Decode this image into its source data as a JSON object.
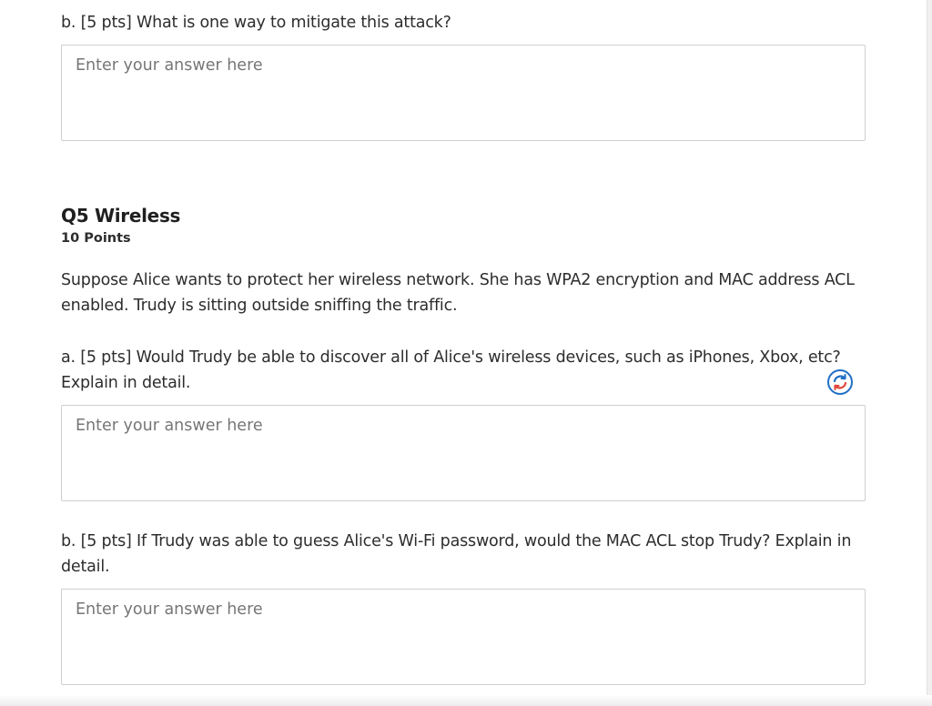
{
  "prev_question": {
    "part_b": {
      "prompt": "b. [5 pts] What is one way to mitigate this attack?",
      "answer_placeholder": "Enter your answer here",
      "answer_value": ""
    }
  },
  "question": {
    "title": "Q5 Wireless",
    "points": "10 Points",
    "description": "Suppose Alice wants to protect her wireless network. She has WPA2 encryption and MAC address ACL enabled. Trudy is sitting outside sniffing the traffic.",
    "parts": [
      {
        "prompt": "a. [5 pts] Would Trudy be able to discover all of Alice's wireless devices, such as iPhones, Xbox, etc? Explain in detail.",
        "answer_placeholder": "Enter your answer here",
        "answer_value": ""
      },
      {
        "prompt": "b. [5 pts] If Trudy was able to guess Alice's Wi-Fi password, would the MAC ACL stop Trudy? Explain in detail.",
        "answer_placeholder": "Enter your answer here",
        "answer_value": ""
      }
    ]
  },
  "icons": {
    "sync": "sync-icon"
  },
  "colors": {
    "text": "#2d2d2d",
    "placeholder": "#767676",
    "box_border": "#cfcfcf",
    "sync_blue": "#1f6fc5",
    "sync_red": "#e0463a"
  }
}
